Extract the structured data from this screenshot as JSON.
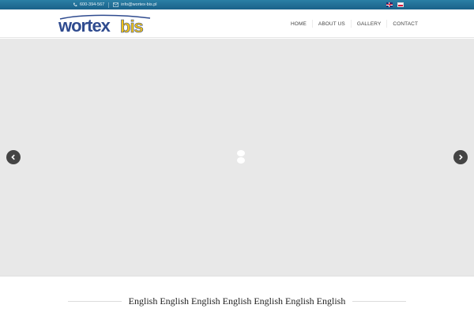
{
  "topbar": {
    "phone": "600-394-567",
    "email": "info@wortex-bis.pl",
    "languages": [
      "English",
      "Polski"
    ]
  },
  "logo": {
    "text_main": "wortex",
    "text_accent": "bis",
    "main_color": "#2f4b8f",
    "accent_color": "#f2c318"
  },
  "nav": {
    "items": [
      "HOME",
      "ABOUT US",
      "GALLERY",
      "CONTACT"
    ]
  },
  "slider": {
    "prev_icon": "chevron-left-icon",
    "next_icon": "chevron-right-icon",
    "loading": true
  },
  "section": {
    "title": "English English English English English English English"
  },
  "colors": {
    "topbar": "#1f6e98",
    "slider_bg": "#e8e8e8",
    "arrow_bg": "#444444"
  }
}
